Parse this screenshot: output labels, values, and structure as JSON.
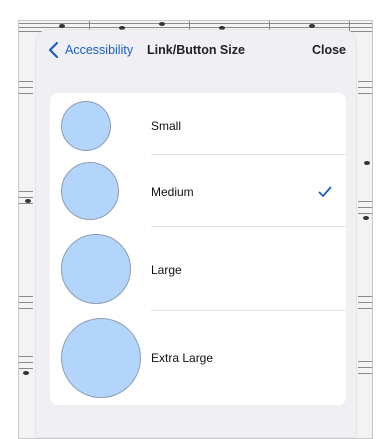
{
  "navbar": {
    "back_label": "Accessibility",
    "title": "Link/Button Size",
    "close_label": "Close"
  },
  "sizes": [
    {
      "label": "Small",
      "selected": false
    },
    {
      "label": "Medium",
      "selected": true
    },
    {
      "label": "Large",
      "selected": false
    },
    {
      "label": "Extra Large",
      "selected": false
    }
  ],
  "colors": {
    "accent": "#1b5fc4",
    "circle_fill": "#b4d5fb",
    "sheet_bg": "#efeff4"
  },
  "icons": {
    "back": "chevron-left-icon",
    "selected": "checkmark-icon"
  }
}
